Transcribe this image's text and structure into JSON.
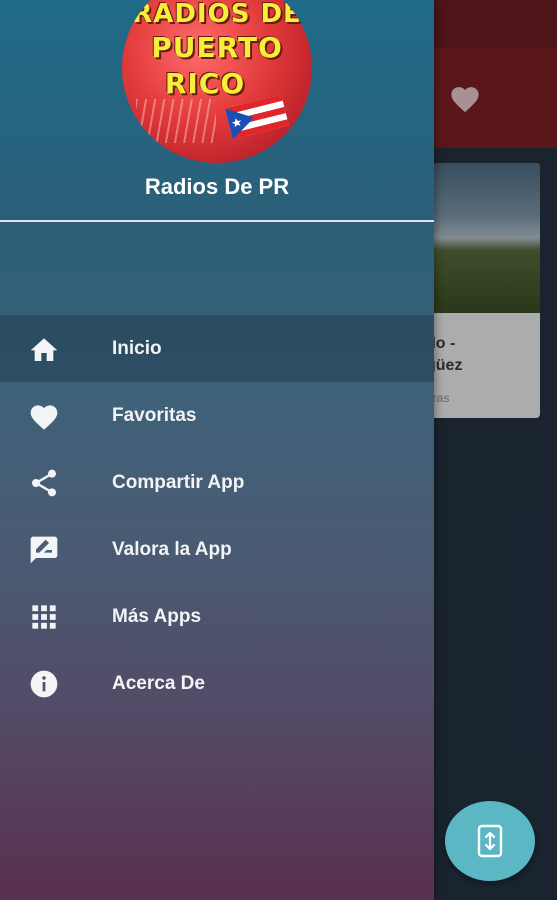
{
  "drawer": {
    "logo": {
      "line1": "RADIOS DE",
      "line2": "PUERTO",
      "line3": "RICO"
    },
    "app_name": "Radios De PR",
    "menu": [
      {
        "label": "Inicio",
        "icon": "home-icon",
        "active": true
      },
      {
        "label": "Favoritas",
        "icon": "heart-icon",
        "active": false
      },
      {
        "label": "Compartir App",
        "icon": "share-icon",
        "active": false
      },
      {
        "label": "Valora la App",
        "icon": "rate-review-icon",
        "active": false
      },
      {
        "label": "Más Apps",
        "icon": "apps-grid-icon",
        "active": false
      },
      {
        "label": "Acerca De",
        "icon": "info-icon",
        "active": false
      }
    ]
  },
  "background_app": {
    "card": {
      "title_line1": "do -",
      "title_line2": "güez",
      "subtitle": "oras"
    }
  },
  "colors": {
    "drawer_top": "#1f6b89",
    "drawer_bottom": "#5a2f50",
    "appbar": "#7c2026",
    "fab": "#5bb7c4",
    "logo_text": "#f7ee3a"
  }
}
